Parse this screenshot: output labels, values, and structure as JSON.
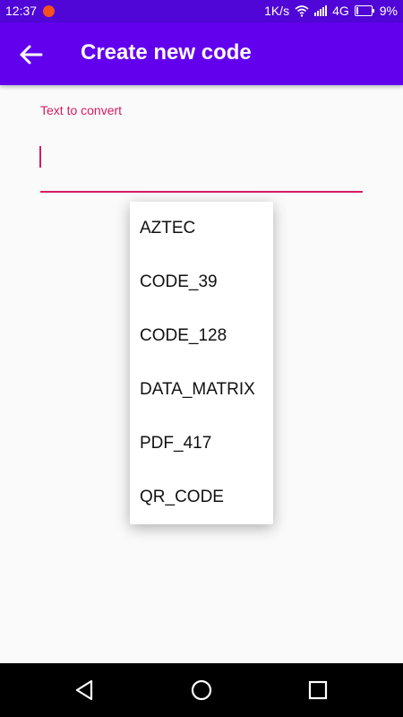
{
  "status_bar": {
    "time": "12:37",
    "speed": "1K/s",
    "network": "4G",
    "battery": "9%",
    "icons": [
      "notification-icon",
      "wifi-icon",
      "signal-icon",
      "battery-icon"
    ]
  },
  "app_bar": {
    "title": "Create new code",
    "back_icon": "arrow-back-icon",
    "color": "#6200ee"
  },
  "form": {
    "label": "Text to convert",
    "value": "",
    "accent": "#d81b60"
  },
  "dropdown": {
    "options": [
      "AZTEC",
      "CODE_39",
      "CODE_128",
      "DATA_MATRIX",
      "PDF_417",
      "QR_CODE"
    ]
  },
  "nav_bar": {
    "icons": [
      "back-triangle-icon",
      "home-circle-icon",
      "recents-square-icon"
    ]
  }
}
